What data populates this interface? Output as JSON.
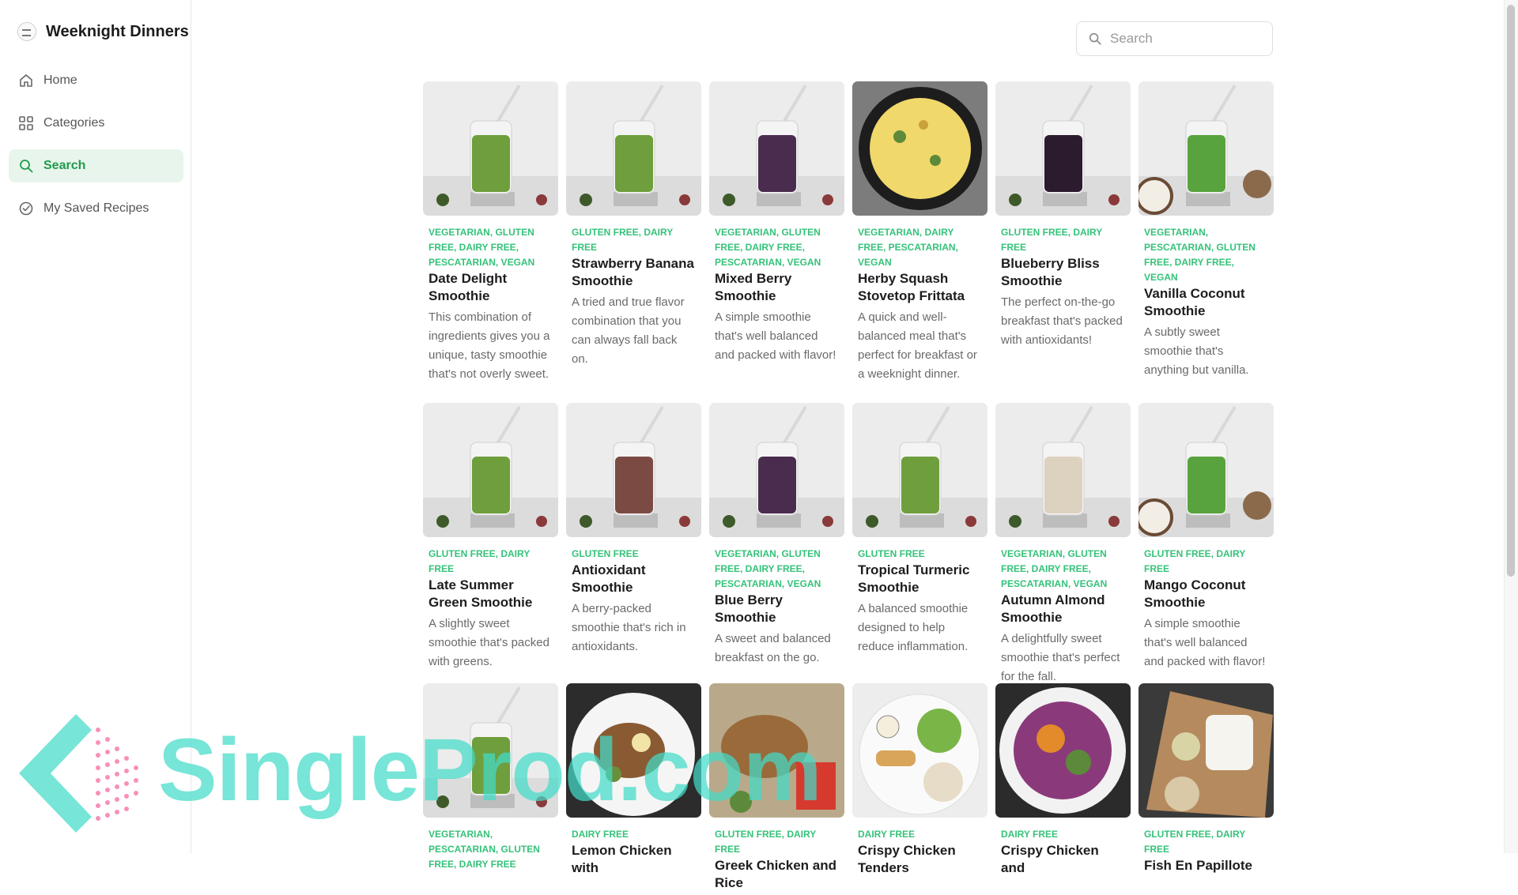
{
  "app": {
    "name": "Weeknight Dinners"
  },
  "sidebar": {
    "items": [
      {
        "label": "Home",
        "icon": "home-icon",
        "active": false
      },
      {
        "label": "Categories",
        "icon": "grid-icon",
        "active": false
      },
      {
        "label": "Search",
        "icon": "search-icon",
        "active": true
      },
      {
        "label": "My Saved Recipes",
        "icon": "check-circle-icon",
        "active": false
      }
    ]
  },
  "search": {
    "placeholder": "Search",
    "value": ""
  },
  "colors": {
    "accent": "#1f9b4a",
    "tag": "#35c27a",
    "active_bg": "#e8f5ec",
    "watermark": "#42dbc8"
  },
  "watermark": {
    "text": "SingleProd.com"
  },
  "recipes": [
    {
      "tags": "VEGETARIAN, GLUTEN FREE, DAIRY FREE, PESCATARIAN, VEGAN",
      "title": "Date Delight Smoothie",
      "description": "This combination of ingredients gives you a unique, tasty smoothie that's not overly sweet.",
      "image": "green-smoothie"
    },
    {
      "tags": "GLUTEN FREE, DAIRY FREE",
      "title": "Strawberry Banana Smoothie",
      "description": "A tried and true flavor combination that you can always fall back on.",
      "image": "green-smoothie"
    },
    {
      "tags": "VEGETARIAN, GLUTEN FREE, DAIRY FREE, PESCATARIAN, VEGAN",
      "title": "Mixed Berry Smoothie",
      "description": "A simple smoothie that's well balanced and packed with flavor!",
      "image": "purple-smoothie"
    },
    {
      "tags": "VEGETARIAN, DAIRY FREE, PESCATARIAN, VEGAN",
      "title": "Herby Squash Stovetop Frittata",
      "description": "A quick and well-balanced meal that's perfect for breakfast or a weeknight dinner.",
      "image": "frittata"
    },
    {
      "tags": "GLUTEN FREE, DAIRY FREE",
      "title": "Blueberry Bliss Smoothie",
      "description": "The perfect on-the-go breakfast that's packed with antioxidants!",
      "image": "dark-purple-smoothie"
    },
    {
      "tags": "VEGETARIAN, PESCATARIAN, GLUTEN FREE, DAIRY FREE, VEGAN",
      "title": "Vanilla Coconut Smoothie",
      "description": "A subtly sweet smoothie that's anything but vanilla.",
      "image": "green-smoothie-coconut"
    },
    {
      "tags": "GLUTEN FREE, DAIRY FREE",
      "title": "Late Summer Green Smoothie",
      "description": "A slightly sweet smoothie that's packed with greens.",
      "image": "green-smoothie"
    },
    {
      "tags": "GLUTEN FREE",
      "title": "Antioxidant Smoothie",
      "description": "A berry-packed smoothie that's rich in antioxidants.",
      "image": "brown-smoothie"
    },
    {
      "tags": "VEGETARIAN, GLUTEN FREE, DAIRY FREE, PESCATARIAN, VEGAN",
      "title": "Blue Berry Smoothie",
      "description": "A sweet and balanced breakfast on the go.",
      "image": "purple-smoothie"
    },
    {
      "tags": "GLUTEN FREE",
      "title": "Tropical Turmeric Smoothie",
      "description": "A balanced smoothie designed to help reduce inflammation.",
      "image": "green-smoothie"
    },
    {
      "tags": "VEGETARIAN, GLUTEN FREE, DAIRY FREE, PESCATARIAN, VEGAN",
      "title": "Autumn Almond Smoothie",
      "description": "A delightfully sweet smoothie that's perfect for the fall.",
      "image": "beige-smoothie"
    },
    {
      "tags": "GLUTEN FREE, DAIRY FREE",
      "title": "Mango Coconut Smoothie",
      "description": "A simple smoothie that's well balanced and packed with flavor!",
      "image": "green-smoothie-coconut"
    },
    {
      "tags": "VEGETARIAN, PESCATARIAN, GLUTEN FREE, DAIRY FREE",
      "title": "",
      "description": "",
      "image": "green-smoothie"
    },
    {
      "tags": "DAIRY FREE",
      "title": "Lemon Chicken with",
      "description": "",
      "image": "chicken-plate"
    },
    {
      "tags": "GLUTEN FREE, DAIRY FREE",
      "title": "Greek Chicken and Rice",
      "description": "",
      "image": "chicken-rice"
    },
    {
      "tags": "DAIRY FREE",
      "title": "Crispy Chicken Tenders",
      "description": "",
      "image": "chicken-salad"
    },
    {
      "tags": "DAIRY FREE",
      "title": "Crispy Chicken and",
      "description": "",
      "image": "slaw"
    },
    {
      "tags": "GLUTEN FREE, DAIRY FREE",
      "title": "Fish En Papillote",
      "description": "",
      "image": "fish-parchment"
    }
  ]
}
